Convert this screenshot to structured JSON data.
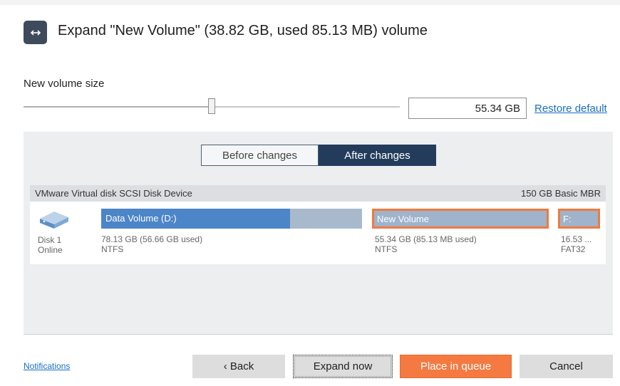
{
  "header": {
    "icon": "expand-horizontal-icon",
    "title": "Expand \"New Volume\" (38.82 GB, used 85.13 MB) volume"
  },
  "size": {
    "label": "New volume size",
    "value": "55.34 GB",
    "slider_position": 0.5,
    "restore_label": "Restore default"
  },
  "tabs": {
    "before": "Before changes",
    "after": "After changes",
    "active": "after"
  },
  "disk": {
    "name": "VMware Virtual disk SCSI Disk Device",
    "info": "150 GB Basic MBR",
    "icon": "disk-drive-icon",
    "label": "Disk 1",
    "status": "Online",
    "partitions": [
      {
        "label": "Data Volume (D:)",
        "size": "78.13 GB (56.66 GB used)",
        "fs": "NTFS",
        "used_fraction": 0.725,
        "color": "#4c85c8"
      },
      {
        "label": "New Volume",
        "size": "55.34 GB (85.13 MB used)",
        "fs": "NTFS",
        "highlight": "#f07a3e"
      },
      {
        "label": "F:",
        "size": "16.53 ...",
        "fs": "FAT32",
        "highlight": "#f07a3e"
      }
    ]
  },
  "footer": {
    "notifications": "Notifications",
    "back": "‹ Back",
    "expand_now": "Expand now",
    "place_in_queue": "Place in queue",
    "cancel": "Cancel"
  },
  "colors": {
    "accent_orange": "#f47a42",
    "tab_active": "#233c5c",
    "link": "#1a6fc1"
  }
}
